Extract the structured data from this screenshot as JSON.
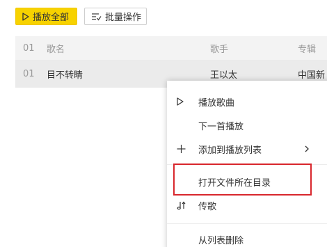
{
  "toolbar": {
    "play_all_label": "播放全部",
    "batch_label": "批量操作"
  },
  "song_list": {
    "header": {
      "index": "01",
      "title": "歌名",
      "artist": "歌手",
      "album": "专辑"
    },
    "rows": [
      {
        "index": "01",
        "title": "目不转睛",
        "artist": "王以太",
        "album": "中国新"
      }
    ]
  },
  "context_menu": {
    "items": [
      {
        "label": "播放歌曲",
        "icon": "play-icon"
      },
      {
        "label": "下一首播放"
      },
      {
        "label": "添加到播放列表",
        "icon": "plus-icon",
        "has_submenu": true
      },
      {
        "label": "打开文件所在目录",
        "highlighted": true
      },
      {
        "label": "传歌",
        "icon": "music-note-upload-icon"
      },
      {
        "label": "从列表删除"
      }
    ]
  },
  "colors": {
    "accent_yellow": "#f7d200",
    "highlight_red": "#d8262c",
    "row_selected": "#ebebeb",
    "header_bg": "#f3f3f3"
  }
}
